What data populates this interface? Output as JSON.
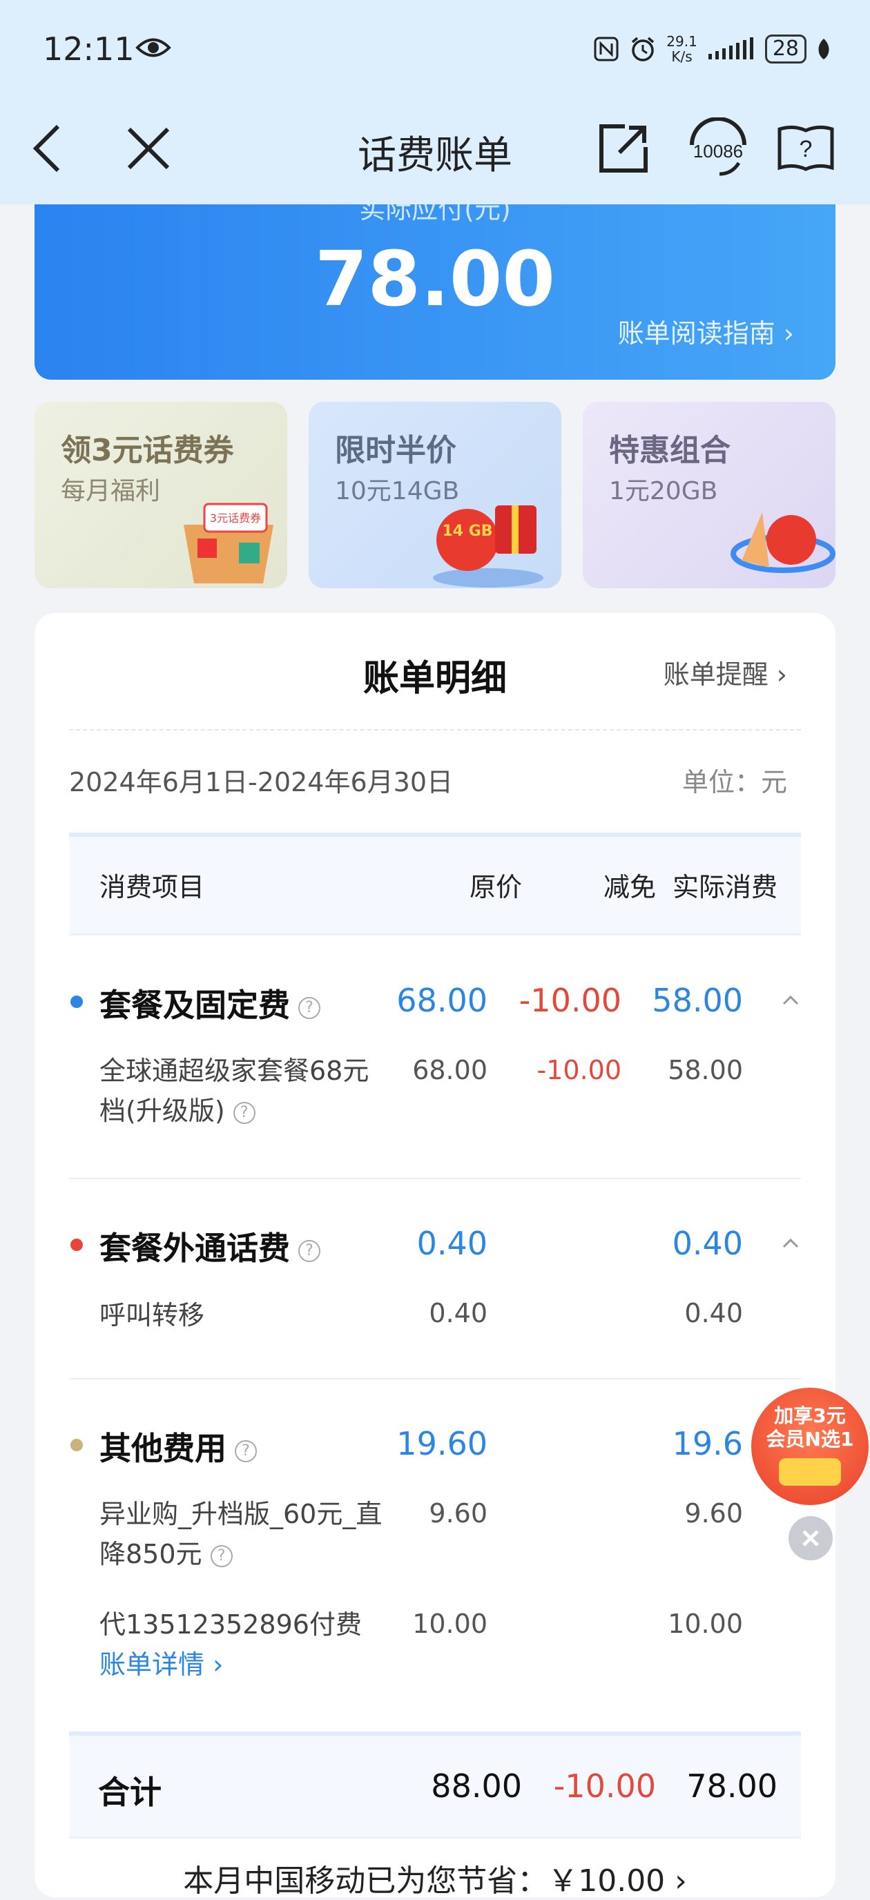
{
  "status_bar": {
    "time": "12:11",
    "net_speed_top": "29.1",
    "net_speed_unit": "K/s",
    "battery": "28"
  },
  "nav": {
    "title": "话费账单",
    "service_number": "10086"
  },
  "hero": {
    "subtitle": "实际应付(元)",
    "amount": "78.00",
    "guide_link": "账单阅读指南 ›"
  },
  "promos": [
    {
      "title": "领3元话费券",
      "subtitle": "每月福利",
      "badge": "3元话费券"
    },
    {
      "title": "限时半价",
      "subtitle": "10元14GB",
      "badge": "14 GB"
    },
    {
      "title": "特惠组合",
      "subtitle": "1元20GB"
    }
  ],
  "bill": {
    "title": "账单明细",
    "reminder": "账单提醒 ›",
    "period": "2024年6月1日-2024年6月30日",
    "unit": "单位：元",
    "headers": {
      "item": "消费项目",
      "original": "原价",
      "discount": "减免",
      "actual": "实际消费"
    },
    "sections": [
      {
        "name": "套餐及固定费",
        "original": "68.00",
        "discount": "-10.00",
        "actual": "58.00",
        "items": [
          {
            "name": "全球通超级家套餐68元档(升级版)",
            "original": "68.00",
            "discount": "-10.00",
            "actual": "58.00"
          }
        ]
      },
      {
        "name": "套餐外通话费",
        "original": "0.40",
        "discount": "",
        "actual": "0.40",
        "items": [
          {
            "name": "呼叫转移",
            "original": "0.40",
            "discount": "",
            "actual": "0.40"
          }
        ]
      },
      {
        "name": "其他费用",
        "original": "19.60",
        "discount": "",
        "actual": "19.6",
        "items": [
          {
            "name": "异业购_升档版_60元_直降850元",
            "original": "9.60",
            "discount": "",
            "actual": "9.60"
          },
          {
            "name_prefix": "代13512352896付费",
            "link": "账单详情 ›",
            "original": "10.00",
            "discount": "",
            "actual": "10.00"
          }
        ]
      }
    ],
    "total": {
      "label": "合计",
      "original": "88.00",
      "discount": "-10.00",
      "actual": "78.00"
    },
    "footer_partial": "本月中国移动已为您节省：￥10.00 ›"
  },
  "float_ad": {
    "line1": "加享3元",
    "line2": "会员N选1"
  },
  "colors": {
    "blue": "#2b85e4",
    "red": "#e5483b",
    "hero_start": "#2b83f0",
    "hero_end": "#46a6f7"
  }
}
